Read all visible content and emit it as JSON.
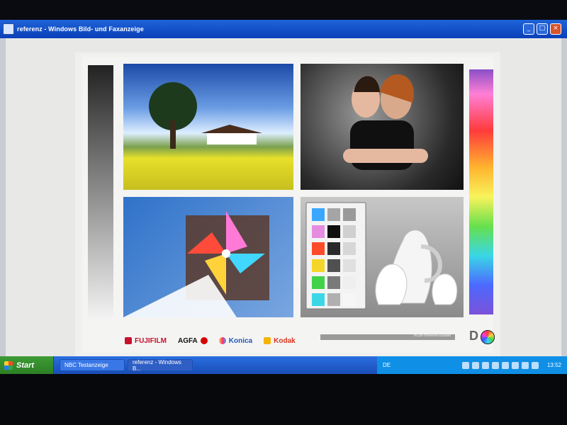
{
  "window": {
    "title": "referenz - Windows Bild- und Faxanzeige",
    "buttons": {
      "minimize": "_",
      "maximize": "□",
      "close": "×"
    }
  },
  "viewer": {
    "top_left_note": "",
    "top_center_note": "",
    "top_right_note": "",
    "bottom_bar_left": "",
    "bottom_bar_right": "RGB-Referenzdatei",
    "logos": [
      "FUJIFILM",
      "AGFA",
      "Konica",
      "Kodak"
    ],
    "brand_mark_text": "D"
  },
  "taskbar": {
    "start_label": "Start",
    "tasks": [
      {
        "label": "NBC Testanzeige"
      },
      {
        "label": "referenz - Windows B..."
      }
    ],
    "language": "DE",
    "clock": "13:52"
  },
  "colors": {
    "title_bar": "#1f64d8",
    "taskbar": "#1a4db6",
    "start_button": "#2c7f25"
  },
  "icons": {
    "app": "picture-viewer-icon",
    "start": "windows-flag-icon"
  }
}
